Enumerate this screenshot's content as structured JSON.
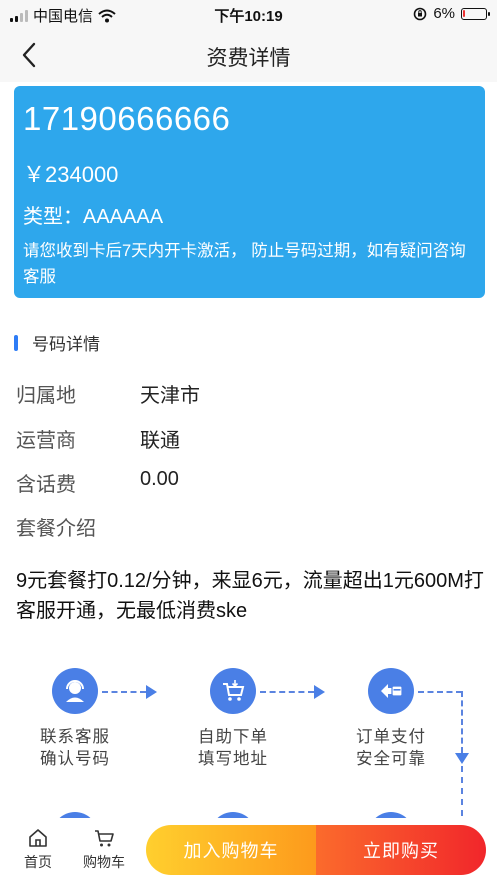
{
  "status_bar": {
    "carrier": "中国电信",
    "time": "下午10:19",
    "battery": "6%",
    "battery_level": 0.06
  },
  "nav": {
    "title": "资费详情"
  },
  "card": {
    "phone": "17190666666",
    "price": "￥234000",
    "type": "类型：AAAAAA",
    "tip": "请您收到卡后7天内开卡激活， 防止号码过期，如有疑问咨询客服"
  },
  "section": {
    "title": "号码详情"
  },
  "details": [
    {
      "label": "归属地",
      "value": "天津市"
    },
    {
      "label": "运营商",
      "value": "联通"
    },
    {
      "label": "含话费",
      "value": "0.00"
    },
    {
      "label": "套餐介绍",
      "value": ""
    }
  ],
  "description": "9元套餐打0.12/分钟，来显6元，流量超出1元600M打客服开通，无最低消费ske",
  "process": [
    {
      "line1": "联系客服",
      "line2": "确认号码",
      "icon": "customer-service-icon"
    },
    {
      "line1": "自助下单",
      "line2": "填写地址",
      "icon": "cart-icon"
    },
    {
      "line1": "订单支付",
      "line2": "安全可靠",
      "icon": "payment-icon"
    }
  ],
  "bottom": {
    "home_label": "首页",
    "cart_label": "购物车",
    "add_cart_label": "加入购物车",
    "buy_label": "立即购买"
  },
  "colors": {
    "card": "#2ea7ec",
    "accent": "#2e7cf6",
    "cart_button": "#fdb52a",
    "buy_button": "#f33e2c"
  }
}
